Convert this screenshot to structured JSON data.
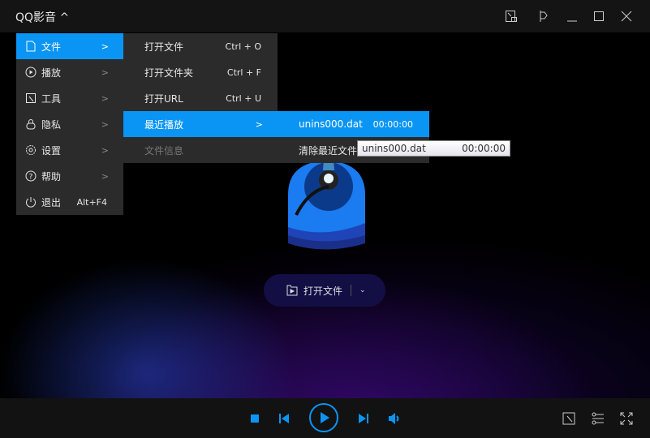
{
  "app": {
    "title": "QQ影音",
    "title_caret": "^"
  },
  "main_menu": [
    {
      "label": "文件",
      "icon": "file-icon",
      "arrow": true,
      "active": true
    },
    {
      "label": "播放",
      "icon": "play-circle-icon",
      "arrow": true
    },
    {
      "label": "工具",
      "icon": "tools-icon",
      "arrow": true
    },
    {
      "label": "隐私",
      "icon": "lock-icon",
      "arrow": true
    },
    {
      "label": "设置",
      "icon": "gear-icon",
      "arrow": true
    },
    {
      "label": "帮助",
      "icon": "help-icon",
      "arrow": true
    },
    {
      "label": "退出",
      "icon": "power-icon",
      "shortcut": "Alt+F4"
    }
  ],
  "file_menu": [
    {
      "label": "打开文件",
      "shortcut": "Ctrl + O"
    },
    {
      "label": "打开文件夹",
      "shortcut": "Ctrl + F"
    },
    {
      "label": "打开URL",
      "shortcut": "Ctrl + U"
    },
    {
      "label": "最近播放",
      "arrow": true,
      "active": true
    },
    {
      "label": "文件信息",
      "disabled": true
    }
  ],
  "recent_menu": [
    {
      "label": "unins000.dat",
      "time": "00:00:00"
    },
    {
      "label": "清除最近文件"
    }
  ],
  "tooltip": {
    "label": "unins000.dat",
    "time": "00:00:00"
  },
  "open_button": {
    "label": "打开文件"
  },
  "colors": {
    "accent": "#0a95f5",
    "menu_bg": "#2b2b2b",
    "titlebar": "#141414"
  }
}
